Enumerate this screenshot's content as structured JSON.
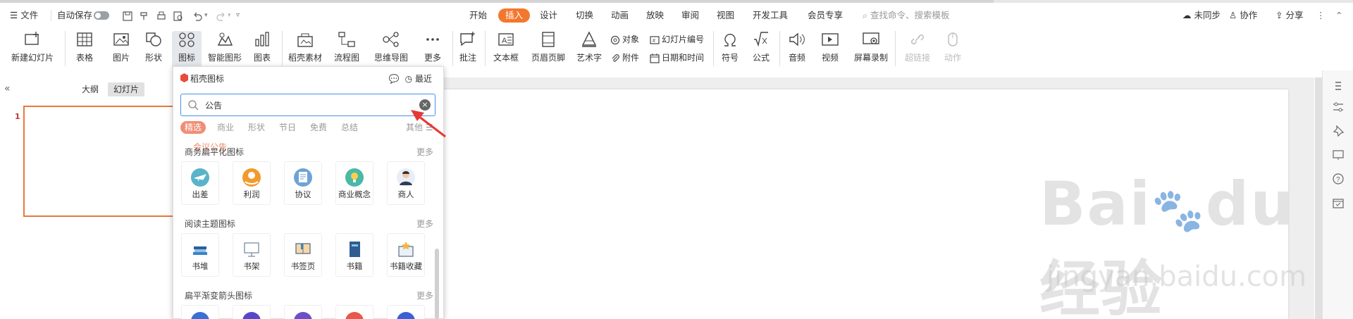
{
  "menubar": {
    "file_label": "文件",
    "autosave_label": "自动保存",
    "tabs": [
      "开始",
      "插入",
      "设计",
      "切换",
      "动画",
      "放映",
      "审阅",
      "视图",
      "开发工具",
      "会员专享"
    ],
    "active_tab": "插入",
    "search_placeholder": "查找命令、搜索模板",
    "sync_label": "未同步",
    "collab_label": "协作",
    "share_label": "分享"
  },
  "ribbon": {
    "new_slide": "新建幻灯片",
    "table": "表格",
    "picture": "图片",
    "shape": "形状",
    "icon": "图标",
    "smart_graphic": "智能图形",
    "chart": "图表",
    "daoke_material": "稻壳素材",
    "flowchart": "流程图",
    "mindmap": "思维导图",
    "more": "更多",
    "comment": "批注",
    "textbox": "文本框",
    "header_footer": "页眉页脚",
    "wordart": "艺术字",
    "object": "对象",
    "attachment": "附件",
    "slide_number": "幻灯片编号",
    "date_time": "日期和时间",
    "symbol": "符号",
    "formula": "公式",
    "audio": "音频",
    "video": "视频",
    "screen_record": "屏幕录制",
    "hyperlink": "超链接",
    "action": "动作"
  },
  "leftpanel": {
    "tab_outline": "大纲",
    "tab_slides": "幻灯片",
    "slide_number": "1"
  },
  "icon_panel": {
    "title": "稻壳图标",
    "recent": "最近",
    "search_value": "公告",
    "filters": [
      "精选",
      "商业",
      "形状",
      "节日",
      "免费",
      "总结",
      "其他"
    ],
    "suggestion": "会议公告",
    "sections": [
      {
        "title": "商务扁平化图标",
        "more": "更多",
        "items": [
          "出差",
          "利润",
          "协议",
          "商业概念",
          "商人"
        ]
      },
      {
        "title": "阅读主题图标",
        "more": "更多",
        "items": [
          "书堆",
          "书架",
          "书签页",
          "书籍",
          "书籍收藏"
        ]
      },
      {
        "title": "扁平渐变箭头图标",
        "more": "更多",
        "items": []
      }
    ]
  },
  "watermark": {
    "logo_text": "Bai",
    "logo_text2": "du",
    "logo_cn": "经验",
    "url": "jingyan.baidu.com"
  },
  "colors": {
    "accent": "#f4772e",
    "search_border": "#4a90e2",
    "slide_border": "#e8793a",
    "annotation_arrow": "#e53935"
  }
}
